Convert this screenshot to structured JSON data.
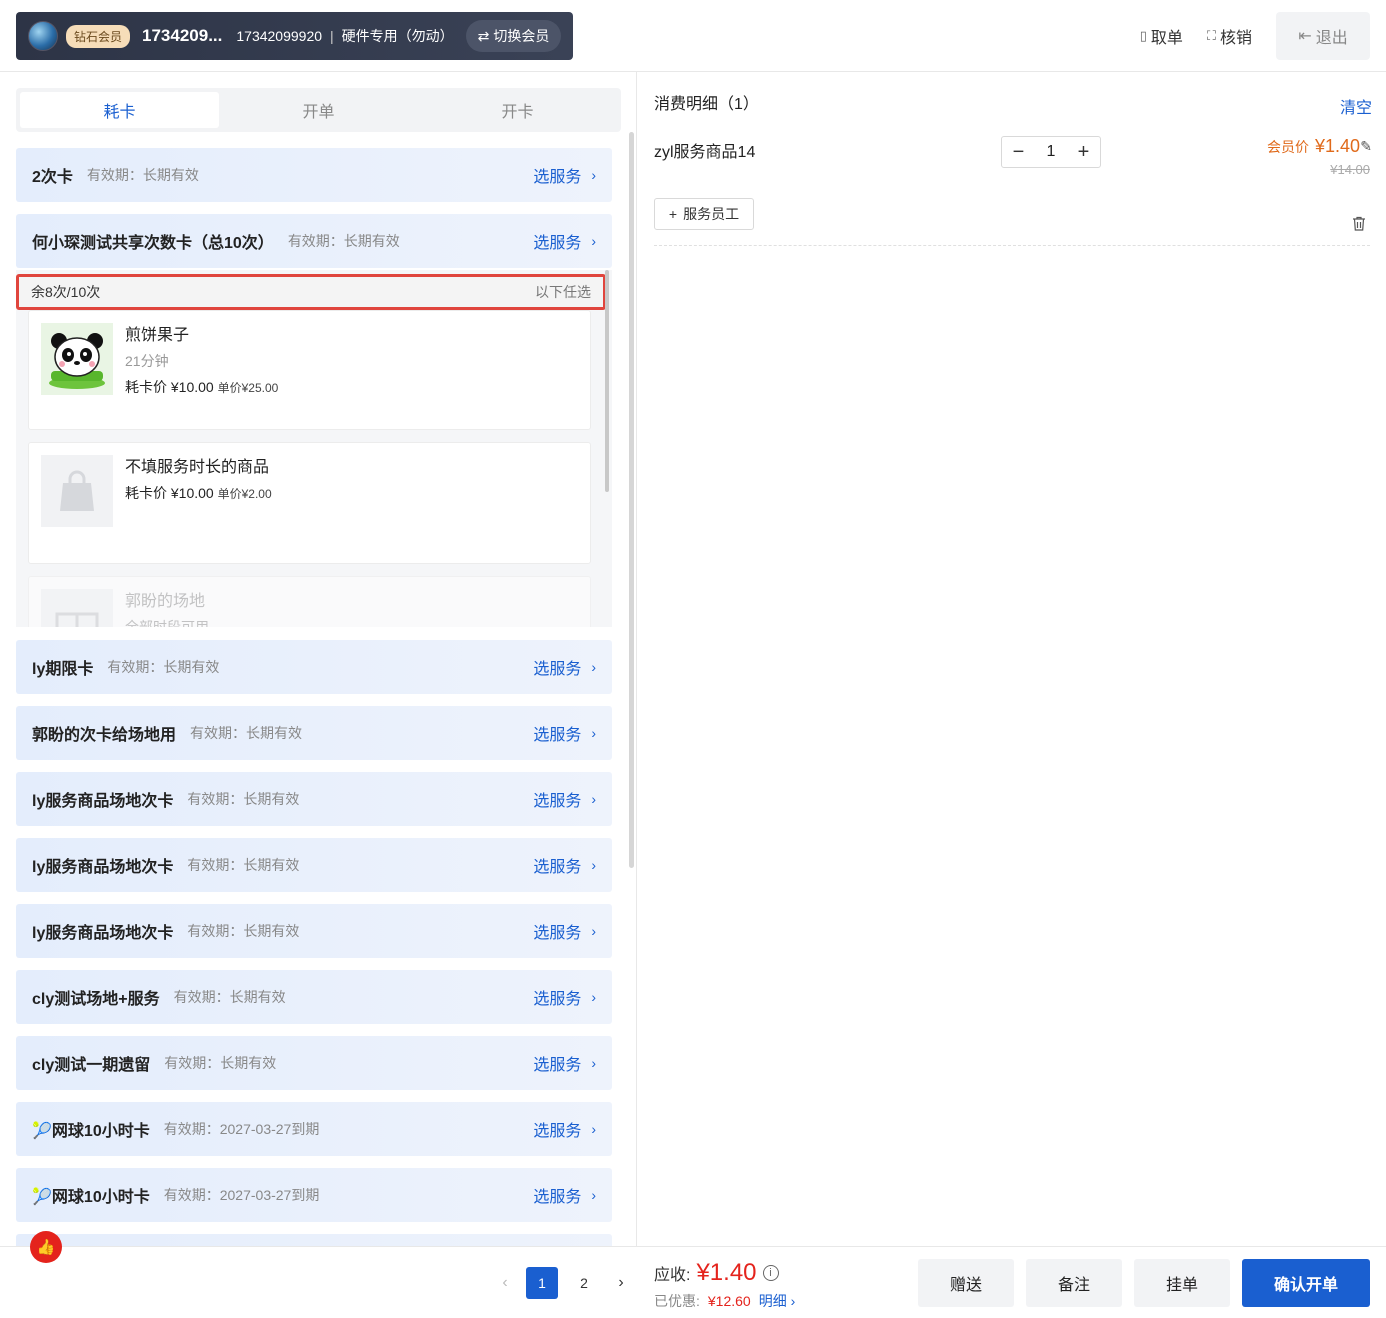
{
  "header": {
    "member_level": "钻石会员",
    "member_name": "1734209...",
    "member_phone": "17342099920",
    "separator": "|",
    "member_note": "硬件专用（勿动）",
    "switch_label": "切换会员",
    "take_order_label": "取单",
    "verify_label": "核销",
    "exit_label": "退出"
  },
  "tabs": [
    {
      "label": "耗卡",
      "active": true
    },
    {
      "label": "开单",
      "active": false
    },
    {
      "label": "开卡",
      "active": false
    }
  ],
  "cards": [
    {
      "name": "2次卡",
      "validity": "有效期：长期有效",
      "action": "选服务"
    },
    {
      "name": "何小琛测试共享次数卡（总10次）",
      "validity": "有效期：长期有效",
      "action": "选服务"
    },
    {
      "name": "ly期限卡",
      "validity": "有效期：长期有效",
      "action": "选服务"
    },
    {
      "name": "郭盼的次卡给场地用",
      "validity": "有效期：长期有效",
      "action": "选服务"
    },
    {
      "name": "ly服务商品场地次卡",
      "validity": "有效期：长期有效",
      "action": "选服务"
    },
    {
      "name": "ly服务商品场地次卡",
      "validity": "有效期：长期有效",
      "action": "选服务"
    },
    {
      "name": "ly服务商品场地次卡",
      "validity": "有效期：长期有效",
      "action": "选服务"
    },
    {
      "name": "cly测试场地+服务",
      "validity": "有效期：长期有效",
      "action": "选服务"
    },
    {
      "name": "cly测试一期遗留",
      "validity": "有效期：长期有效",
      "action": "选服务"
    },
    {
      "name": "🎾网球10小时卡",
      "validity": "有效期：2027-03-27到期",
      "action": "选服务"
    },
    {
      "name": "🎾网球10小时卡",
      "validity": "有效期：2027-03-27到期",
      "action": "选服务"
    }
  ],
  "expanded": {
    "remaining": "余8次/10次",
    "option_hint": "以下任选",
    "services": [
      {
        "name": "煎饼果子",
        "duration": "21分钟",
        "price": "耗卡价 ¥10.00",
        "unit_price": "单价¥25.00",
        "image": "panda-image"
      },
      {
        "name": "不填服务时长的商品",
        "duration": "",
        "price": "耗卡价 ¥10.00",
        "unit_price": "单价¥2.00",
        "image": "bag-icon"
      },
      {
        "name": "郭盼的场地",
        "duration": "全部时段可用",
        "price": "",
        "unit_price": "",
        "image": "venue-icon"
      }
    ]
  },
  "detail": {
    "title": "消费明细（1）",
    "clear_label": "清空",
    "item": {
      "name": "zyl服务商品14",
      "quantity": "1",
      "member_price_label": "会员价",
      "member_price": "¥1.40",
      "original_price": "¥14.00",
      "staff_label": "服务员工"
    }
  },
  "pagination": {
    "pages": [
      "1",
      "2"
    ],
    "current": "1"
  },
  "summary": {
    "receivable_label": "应收:",
    "receivable": "¥1.40",
    "discount_label": "已优惠:",
    "discount": "¥12.60",
    "detail_label": "明细"
  },
  "actions": {
    "gift_label": "赠送",
    "remark_label": "备注",
    "hold_label": "挂单",
    "confirm_label": "确认开单"
  },
  "colors": {
    "primary": "#1a5fd0",
    "price_red": "#e4231c",
    "member_orange": "#e06a1b",
    "highlight_border": "#e0453d"
  }
}
